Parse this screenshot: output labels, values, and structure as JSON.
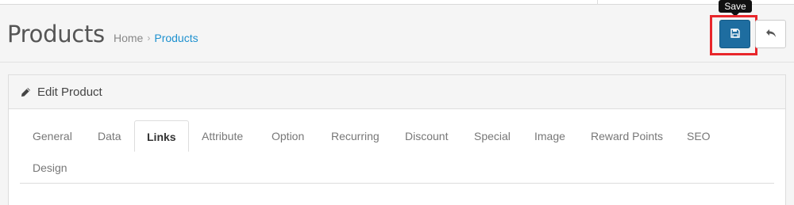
{
  "header": {
    "title": "Products",
    "breadcrumb": {
      "home": "Home",
      "separator": "›",
      "current": "Products"
    }
  },
  "actions": {
    "save_tooltip": "Save",
    "save_icon": "floppy-disk-icon",
    "back_icon": "reply-arrow-icon"
  },
  "panel": {
    "title": "Edit Product",
    "icon": "pencil-icon"
  },
  "tabs": [
    {
      "label": "General",
      "active": false
    },
    {
      "label": "Data",
      "active": false
    },
    {
      "label": "Links",
      "active": true
    },
    {
      "label": "Attribute",
      "active": false
    },
    {
      "label": "Option",
      "active": false
    },
    {
      "label": "Recurring",
      "active": false
    },
    {
      "label": "Discount",
      "active": false
    },
    {
      "label": "Special",
      "active": false
    },
    {
      "label": "Image",
      "active": false
    },
    {
      "label": "Reward Points",
      "active": false
    },
    {
      "label": "SEO",
      "active": false
    },
    {
      "label": "Design",
      "active": false
    }
  ],
  "colors": {
    "primary": "#1e6da0",
    "link": "#1e91cf",
    "highlight": "#e8262b"
  }
}
